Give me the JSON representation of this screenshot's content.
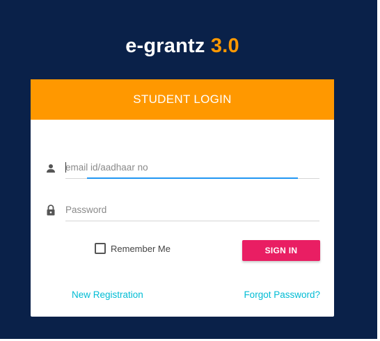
{
  "brand": {
    "name": "e-grantz",
    "version": "3.0"
  },
  "login": {
    "title": "STUDENT LOGIN",
    "email": {
      "placeholder": "email id/aadhaar no",
      "value": ""
    },
    "password": {
      "placeholder": "Password",
      "value": ""
    },
    "remember_label": "Remember Me",
    "remember_checked": false,
    "signin_label": "SIGN IN",
    "register_link": "New Registration",
    "forgot_link": "Forgot Password?"
  },
  "icons": {
    "email": "person-icon",
    "password": "lock-icon"
  },
  "colors": {
    "background": "#0a2149",
    "header": "#ff9800",
    "version": "#ff9800",
    "signin": "#e91e63",
    "links": "#00bcd4",
    "focus": "#2196f3"
  }
}
